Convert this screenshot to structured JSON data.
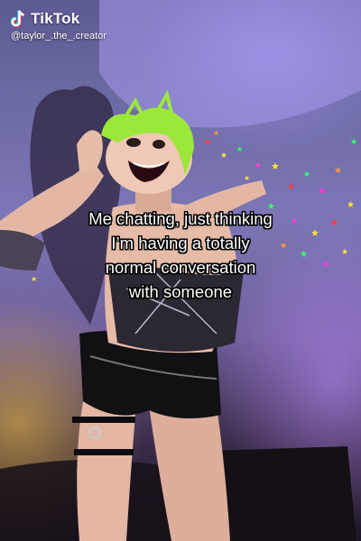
{
  "watermark": {
    "brand": "TikTok",
    "handle": "@taylor_.the_.creator"
  },
  "caption": {
    "lines": [
      "Me chatting, just thinking",
      "I’m having a totally",
      "normal conversation",
      "with someone"
    ]
  },
  "icons": {
    "logo": "tiktok-logo-icon"
  },
  "colors": {
    "hair": "#9be83a",
    "wall": "#7c76b6",
    "light_yellow": "#ffd23c",
    "light_purple": "#b48cff",
    "star_colors": [
      "#ff3b3b",
      "#ffe23b",
      "#3bff6a",
      "#ff3bd2",
      "#ff9a3b"
    ]
  }
}
